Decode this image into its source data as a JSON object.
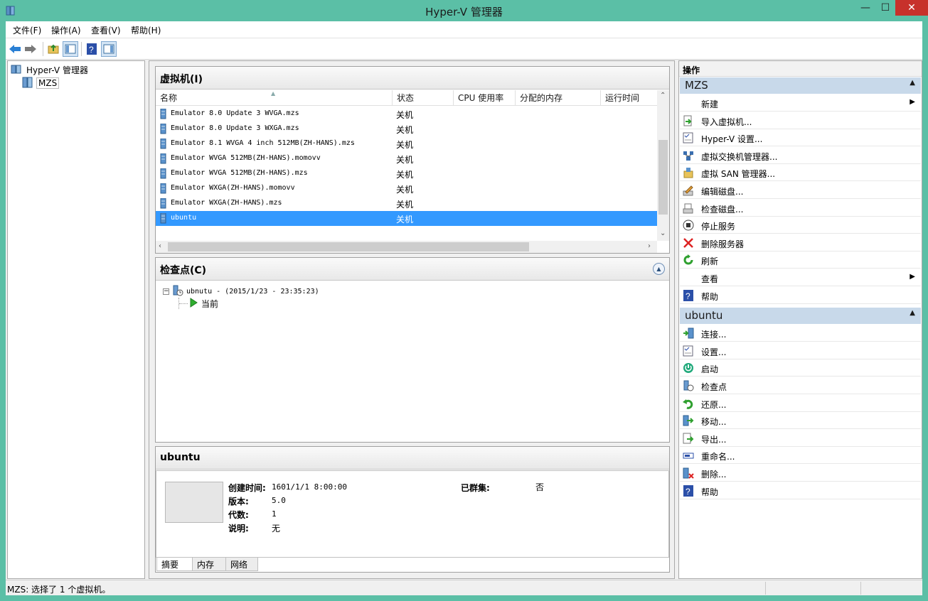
{
  "window": {
    "title": "Hyper-V 管理器",
    "controls": {
      "minimize": "—",
      "maximize": "☐",
      "close": "✕"
    }
  },
  "menu": [
    "文件(F)",
    "操作(A)",
    "查看(V)",
    "帮助(H)"
  ],
  "tree": {
    "root": "Hyper-V 管理器",
    "child": "MZS"
  },
  "vm_panel": {
    "title": "虚拟机(I)",
    "columns": [
      "名称",
      "状态",
      "CPU 使用率",
      "分配的内存",
      "运行时间"
    ],
    "rows": [
      {
        "name": "Emulator 8.0 Update 3 WVGA.mzs",
        "state": "关机"
      },
      {
        "name": "Emulator 8.0 Update 3 WXGA.mzs",
        "state": "关机"
      },
      {
        "name": "Emulator 8.1 WVGA 4 inch 512MB(ZH-HANS).mzs",
        "state": "关机"
      },
      {
        "name": "Emulator WVGA 512MB(ZH-HANS).momovv",
        "state": "关机"
      },
      {
        "name": "Emulator WVGA 512MB(ZH-HANS).mzs",
        "state": "关机"
      },
      {
        "name": "Emulator WXGA(ZH-HANS).momovv",
        "state": "关机"
      },
      {
        "name": "Emulator WXGA(ZH-HANS).mzs",
        "state": "关机"
      },
      {
        "name": "ubuntu",
        "state": "关机"
      }
    ]
  },
  "checkpoint_panel": {
    "title": "检查点(C)",
    "snapshot": "ubnutu - (2015/1/23 - 23:35:23)",
    "current": "当前"
  },
  "details": {
    "title": "ubuntu",
    "fields": [
      {
        "label": "创建时间:",
        "value": "1601/1/1 8:00:00"
      },
      {
        "label": "版本:",
        "value": "5.0"
      },
      {
        "label": "代数:",
        "value": "1"
      },
      {
        "label": "说明:",
        "value": "无"
      }
    ],
    "clustered_label": "已群集:",
    "clustered_value": "否",
    "tabs": [
      "摘要",
      "内存",
      "网络"
    ]
  },
  "actions": {
    "header": "操作",
    "sections": [
      {
        "title": "MZS",
        "items": [
          {
            "label": "新建",
            "icon": "blank-icon",
            "submenu": true
          },
          {
            "label": "导入虚拟机...",
            "icon": "import-vm-icon"
          },
          {
            "label": "Hyper-V 设置...",
            "icon": "settings-icon"
          },
          {
            "label": "虚拟交换机管理器...",
            "icon": "switch-manager-icon"
          },
          {
            "label": "虚拟 SAN 管理器...",
            "icon": "san-manager-icon"
          },
          {
            "label": "编辑磁盘...",
            "icon": "edit-disk-icon"
          },
          {
            "label": "检查磁盘...",
            "icon": "inspect-disk-icon"
          },
          {
            "label": "停止服务",
            "icon": "stop-icon"
          },
          {
            "label": "删除服务器",
            "icon": "delete-x-icon"
          },
          {
            "label": "刷新",
            "icon": "refresh-icon"
          },
          {
            "label": "查看",
            "icon": "blank-icon",
            "submenu": true
          },
          {
            "label": "帮助",
            "icon": "help-icon"
          }
        ]
      },
      {
        "title": "ubuntu",
        "items": [
          {
            "label": "连接...",
            "icon": "connect-icon"
          },
          {
            "label": "设置...",
            "icon": "vm-settings-icon"
          },
          {
            "label": "启动",
            "icon": "power-icon"
          },
          {
            "label": "检查点",
            "icon": "checkpoint-icon"
          },
          {
            "label": "还原...",
            "icon": "revert-icon"
          },
          {
            "label": "移动...",
            "icon": "move-icon"
          },
          {
            "label": "导出...",
            "icon": "export-icon"
          },
          {
            "label": "重命名...",
            "icon": "rename-icon"
          },
          {
            "label": "删除...",
            "icon": "delete-vm-icon"
          },
          {
            "label": "帮助",
            "icon": "help-icon"
          }
        ]
      }
    ]
  },
  "status": "MZS:  选择了 1 个虚拟机。",
  "colors": {
    "frame": "#5bbfa6",
    "selection": "#3399ff",
    "section_head": "#c8d9ea",
    "close": "#c7312b"
  }
}
